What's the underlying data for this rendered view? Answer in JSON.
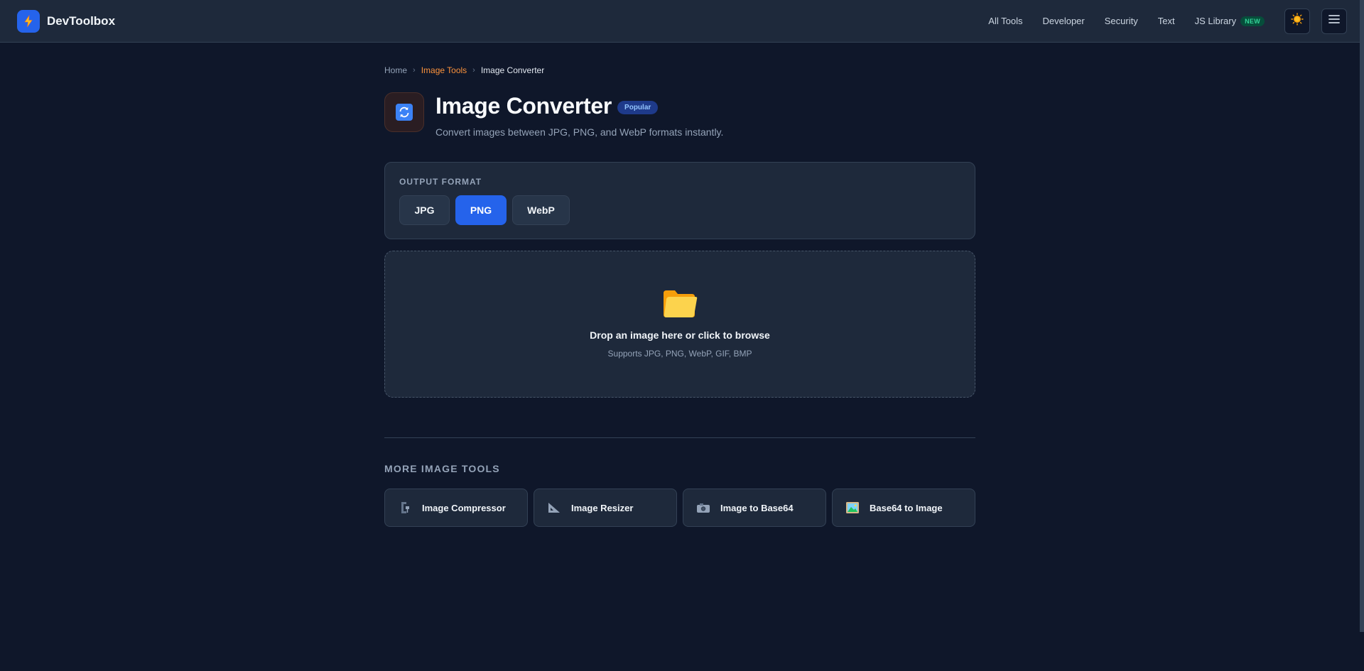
{
  "header": {
    "brand_name": "DevToolbox",
    "nav": [
      "All Tools",
      "Developer",
      "Security",
      "Text"
    ],
    "js_library_label": "JS Library",
    "js_library_badge": "NEW",
    "theme_icon": "sun-icon",
    "menu_icon": "hamburger-icon"
  },
  "breadcrumb": {
    "home": "Home",
    "category": "Image Tools",
    "current": "Image Converter",
    "separator": "›"
  },
  "page": {
    "title": "Image Converter",
    "badge": "Popular",
    "subtitle": "Convert images between JPG, PNG, and WebP formats instantly.",
    "icon": "refresh-icon"
  },
  "output_format": {
    "label": "OUTPUT FORMAT",
    "options": [
      "JPG",
      "PNG",
      "WebP"
    ],
    "selected": "PNG"
  },
  "dropzone": {
    "icon": "folder-icon",
    "title": "Drop an image here or click to browse",
    "subtitle": "Supports JPG, PNG, WebP, GIF, BMP"
  },
  "more_tools": {
    "label": "MORE IMAGE TOOLS",
    "items": [
      {
        "label": "Image Compressor",
        "icon": "clamp-icon"
      },
      {
        "label": "Image Resizer",
        "icon": "ruler-triangle-icon"
      },
      {
        "label": "Image to Base64",
        "icon": "camera-icon"
      },
      {
        "label": "Base64 to Image",
        "icon": "landscape-picture-icon"
      }
    ]
  },
  "colors": {
    "background": "#0f172a",
    "surface": "#1e293b",
    "accent": "#2563eb",
    "breadcrumb_link": "#fb923c"
  }
}
